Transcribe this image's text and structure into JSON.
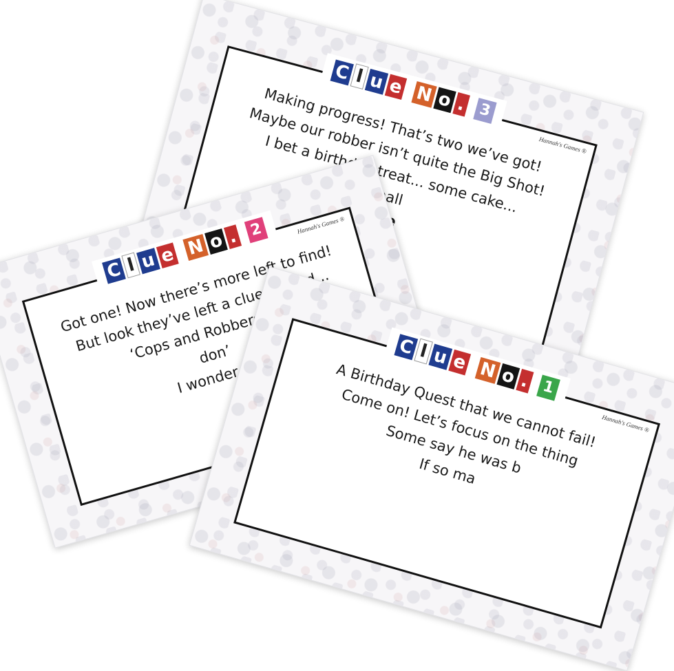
{
  "cards": [
    {
      "heading": [
        "C",
        "l",
        "u",
        "e",
        "N",
        "o",
        ".",
        "3"
      ],
      "brand": "Hannah's Games ®",
      "lines": [
        "Making progress! That’s two we’ve got!",
        "Maybe our robber isn’t quite the Big Shot!",
        "I bet a birthday treat... some cake...",
        "Shall",
        "lace"
      ]
    },
    {
      "heading": [
        "C",
        "l",
        "u",
        "e",
        "N",
        "o",
        ".",
        "2"
      ],
      "brand": "Hannah's Games ®",
      "lines": [
        "Got one! Now there’s more left to find!",
        "But look they’ve left a clue behind...",
        "‘Cops and Robbers’ st,",
        "don’",
        "I wonder if b"
      ]
    },
    {
      "heading": [
        "C",
        "l",
        "u",
        "e",
        "N",
        "o",
        ".",
        "1"
      ],
      "brand": "Hannah's Games ®",
      "lines": [
        "A Birthday Quest that we cannot fail!",
        "Come on! Let’s focus on the thing",
        "Some say he was b",
        "If so ma"
      ]
    }
  ]
}
